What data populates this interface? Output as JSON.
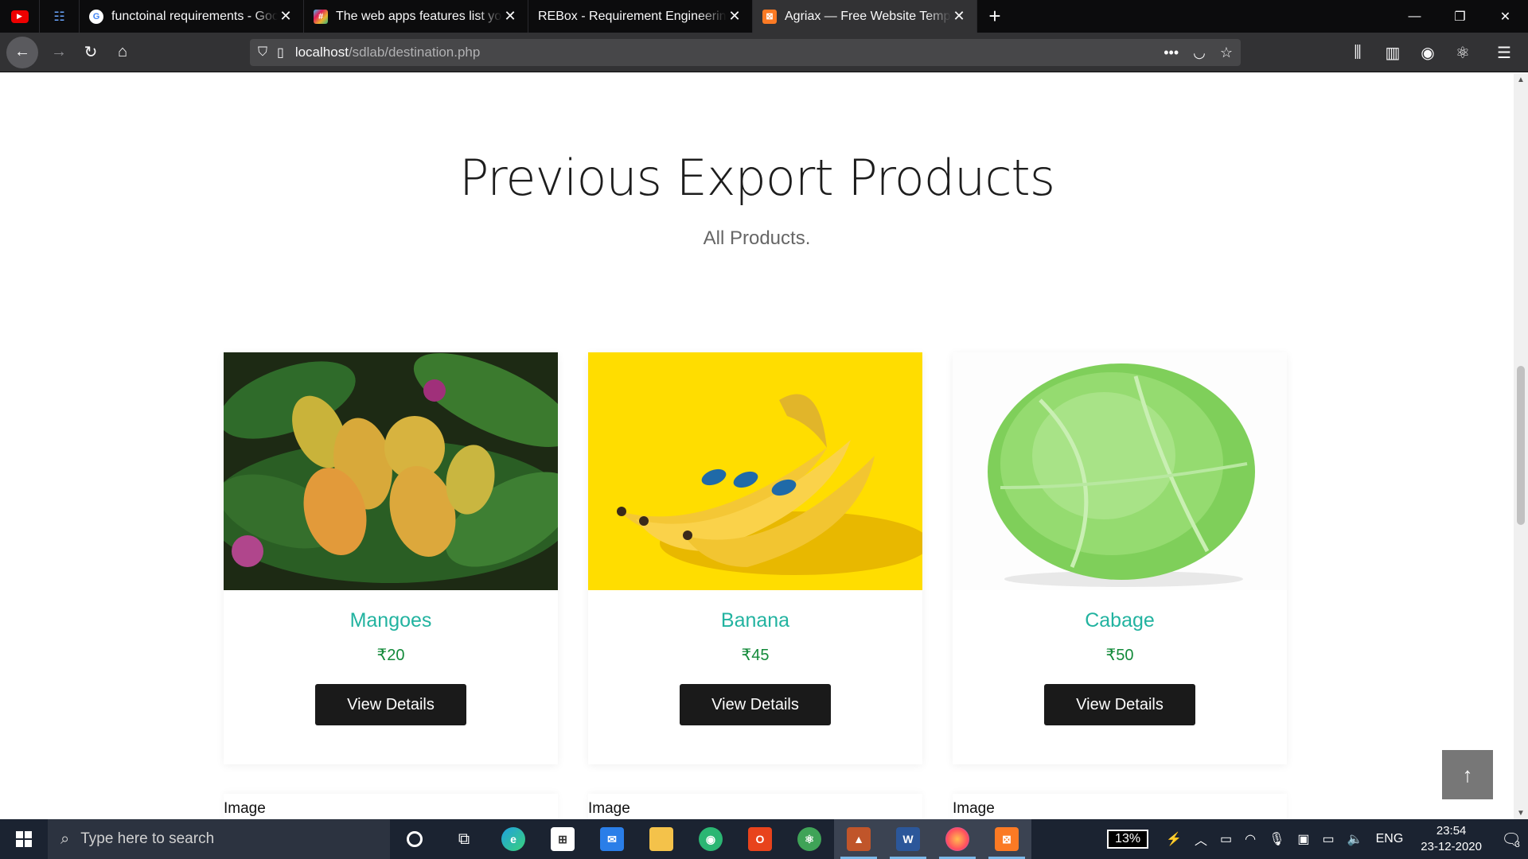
{
  "browser": {
    "tabs": [
      {
        "title": "functoinal requirements - Goog",
        "favicon": "google-icon",
        "active": false
      },
      {
        "title": "The web apps features list you n",
        "favicon": "slack-icon",
        "active": false
      },
      {
        "title": "REBox - Requirement Engineering T",
        "favicon": "none",
        "active": false
      },
      {
        "title": "Agriax — Free Website Templa",
        "favicon": "xampp-icon",
        "active": true
      }
    ],
    "url_host": "localhost",
    "url_path": "/sdlab/destination.php"
  },
  "section": {
    "title": "Previous Export Products",
    "subtitle": "All Products."
  },
  "products": [
    {
      "name": "Mangoes",
      "price": "₹20",
      "button": "View Details",
      "image": "mango-photo"
    },
    {
      "name": "Banana",
      "price": "₹45",
      "button": "View Details",
      "image": "banana-photo"
    },
    {
      "name": "Cabage",
      "price": "₹50",
      "button": "View Details",
      "image": "cabbage-photo"
    }
  ],
  "next_row_labels": [
    "Image",
    "Image",
    "Image"
  ],
  "taskbar": {
    "search_placeholder": "Type here to search",
    "battery": "13%",
    "language": "ENG",
    "time": "23:54",
    "date": "23-12-2020",
    "notifications": "3"
  },
  "colors": {
    "product_name": "#22b3a0",
    "price": "#138a3a",
    "button_bg": "#1a1a1a"
  }
}
